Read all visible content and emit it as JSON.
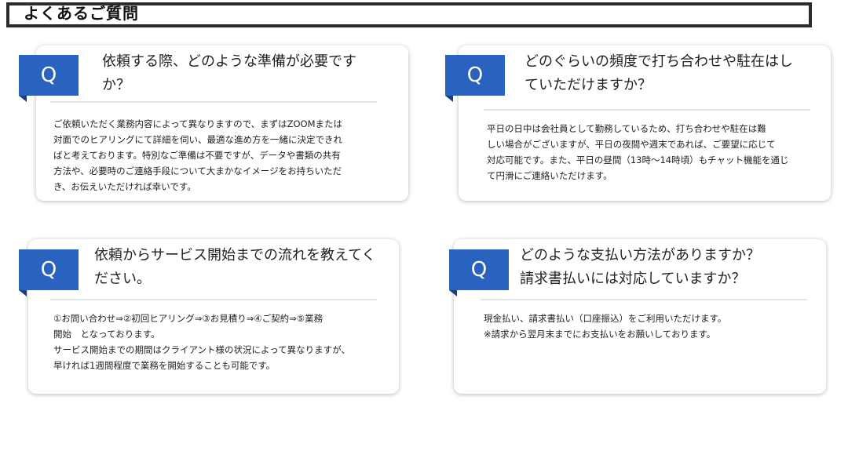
{
  "header": {
    "title": "よくあるご質問"
  },
  "accent_color": "#2a62c0",
  "faq": [
    {
      "badge": "Q",
      "question_lines": [
        "依頼する際、どのような準備が必要です",
        "か？"
      ],
      "answer_lines": [
        "ご依頼いただく業務内容によって異なりますので、まずはZOOMまたは",
        "対面でのヒアリングにて詳細を伺い、最適な進め方を一緒に決定できれ",
        "ばと考えております。特別なご準備は不要ですが、データや書類の共有",
        "方法や、必要時のご連絡手段について大まかなイメージをお持ちいただ",
        "き、お伝えいただければ幸いです。"
      ]
    },
    {
      "badge": "Q",
      "question_lines": [
        "どのぐらいの頻度で打ち合わせや駐在はし",
        "ていただけますか？"
      ],
      "answer_lines": [
        "平日の日中は会社員として勤務しているため、打ち合わせや駐在は難",
        "しい場合がございますが、平日の夜間や週末であれば、ご要望に応じて",
        "対応可能です。また、平日の昼間（13時～14時頃）もチャット機能を通じ",
        "て円滑にご連絡いただけます。"
      ]
    },
    {
      "badge": "Q",
      "question_lines": [
        "依頼からサービス開始までの流れを教えてく",
        "ださい。"
      ],
      "answer_lines": [
        "①お問い合わせ⇒②初回ヒアリング⇒③お見積り⇒④ご契約⇒⑤業務",
        "開始　となっております。",
        "サービス開始までの期間はクライアント様の状況によって異なりますが、",
        "早ければ1週間程度で業務を開始することも可能です。"
      ]
    },
    {
      "badge": "Q",
      "question_lines": [
        "どのような支払い方法がありますか？",
        "請求書払いには対応していますか？"
      ],
      "answer_lines": [
        "現金払い、請求書払い（口座振込）をご利用いただけます。",
        "※請求から翌月末までにお支払いをお願いしております。"
      ]
    }
  ]
}
